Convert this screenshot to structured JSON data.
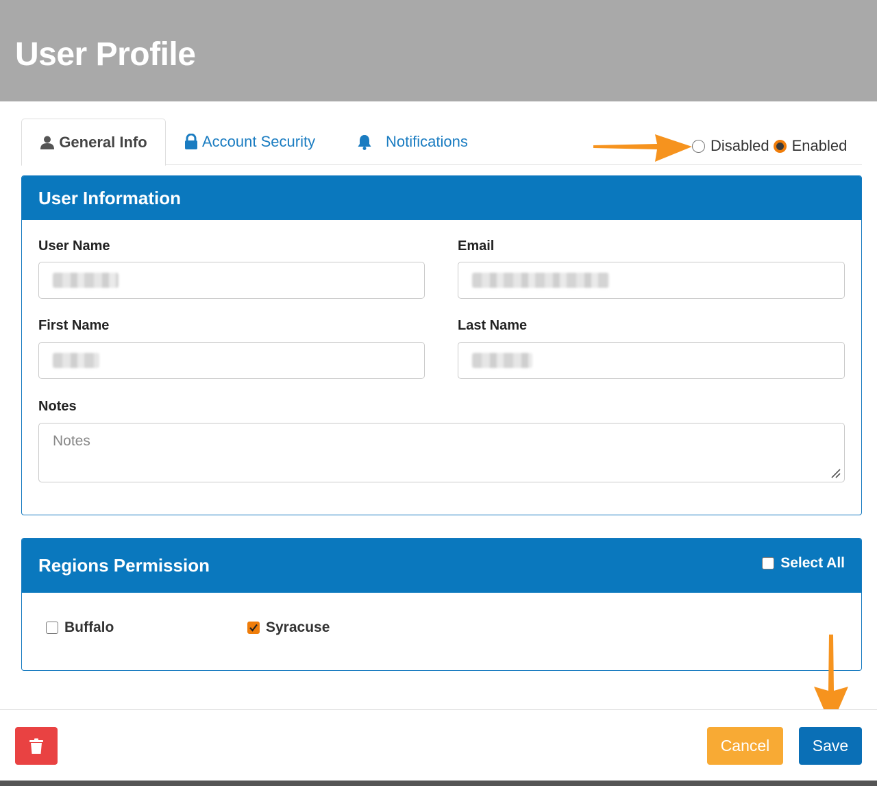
{
  "header": {
    "title": "User Profile"
  },
  "tabs": [
    {
      "label": "General Info",
      "icon": "user-icon",
      "active": true
    },
    {
      "label": "Account Security",
      "icon": "lock-icon",
      "active": false
    },
    {
      "label": "Notifications",
      "icon": "bell-icon",
      "active": false
    }
  ],
  "status_toggle": {
    "options": [
      {
        "label": "Disabled",
        "checked": false
      },
      {
        "label": "Enabled",
        "checked": true
      }
    ]
  },
  "user_info": {
    "title": "User Information",
    "fields": {
      "user_name": {
        "label": "User Name",
        "value": ""
      },
      "email": {
        "label": "Email",
        "value": ""
      },
      "first_name": {
        "label": "First Name",
        "value": ""
      },
      "last_name": {
        "label": "Last Name",
        "value": ""
      },
      "notes": {
        "label": "Notes",
        "placeholder": "Notes",
        "value": ""
      }
    }
  },
  "regions": {
    "title": "Regions Permission",
    "select_all_label": "Select All",
    "select_all_checked": false,
    "items": [
      {
        "label": "Buffalo",
        "checked": false
      },
      {
        "label": "Syracuse",
        "checked": true
      }
    ]
  },
  "footer": {
    "cancel_label": "Cancel",
    "save_label": "Save"
  },
  "colors": {
    "header_bg": "#a9a9a9",
    "panel_header": "#0a78be",
    "accent_orange": "#ef7d0b",
    "delete_red": "#e94242",
    "cancel_amber": "#f8aa34",
    "save_blue": "#0a6fb6",
    "link_blue": "#1a7cc1"
  }
}
